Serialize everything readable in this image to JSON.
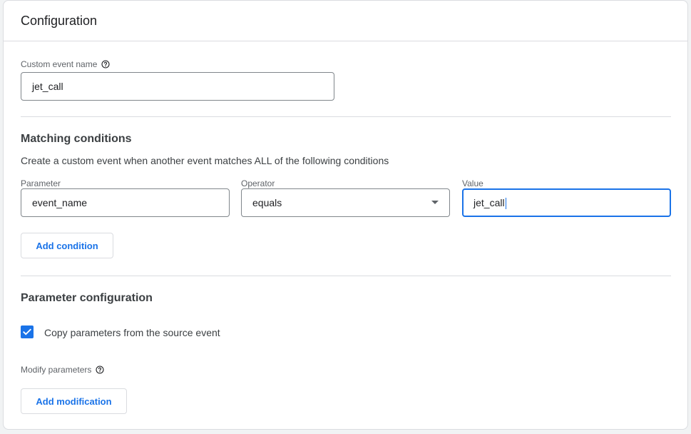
{
  "header": {
    "title": "Configuration"
  },
  "custom_event": {
    "label": "Custom event name",
    "value": "jet_call"
  },
  "matching": {
    "title": "Matching conditions",
    "description": "Create a custom event when another event matches ALL of the following conditions",
    "parameter_label": "Parameter",
    "parameter_value": "event_name",
    "operator_label": "Operator",
    "operator_value": "equals",
    "value_label": "Value",
    "value_value": "jet_call",
    "add_condition_label": "Add condition"
  },
  "param_config": {
    "title": "Parameter configuration",
    "copy_checkbox_label": "Copy parameters from the source event",
    "copy_checked": true,
    "modify_label": "Modify parameters",
    "add_modification_label": "Add modification"
  },
  "colors": {
    "accent": "#1a73e8",
    "border": "#dadce0"
  }
}
